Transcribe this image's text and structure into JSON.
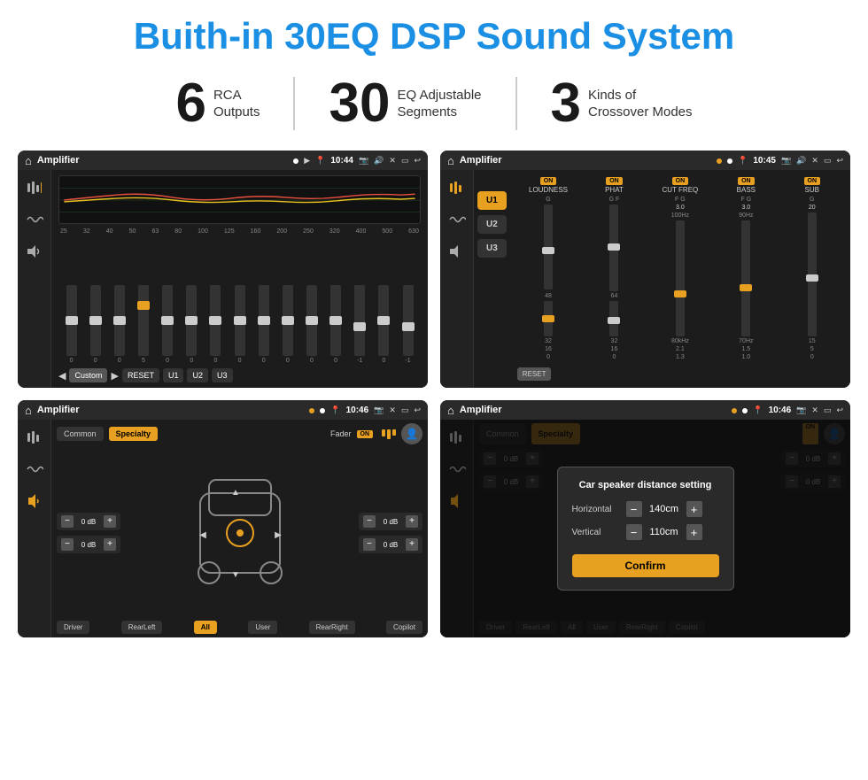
{
  "header": {
    "title": "Buith-in 30EQ DSP Sound System"
  },
  "stats": [
    {
      "number": "6",
      "label_line1": "RCA",
      "label_line2": "Outputs"
    },
    {
      "number": "30",
      "label_line1": "EQ Adjustable",
      "label_line2": "Segments"
    },
    {
      "number": "3",
      "label_line1": "Kinds of",
      "label_line2": "Crossover Modes"
    }
  ],
  "screens": [
    {
      "id": "eq-screen",
      "status_bar": {
        "title": "Amplifier",
        "time": "10:44"
      },
      "eq_labels": [
        "25",
        "32",
        "40",
        "50",
        "63",
        "80",
        "100",
        "125",
        "160",
        "200",
        "250",
        "320",
        "400",
        "500",
        "630"
      ],
      "eq_values": [
        0,
        0,
        0,
        5,
        0,
        0,
        0,
        0,
        0,
        0,
        0,
        0,
        -1,
        0,
        -1
      ],
      "bottom_buttons": [
        "Custom",
        "RESET",
        "U1",
        "U2",
        "U3"
      ]
    },
    {
      "id": "amp2-screen",
      "status_bar": {
        "title": "Amplifier",
        "time": "10:45"
      },
      "presets": [
        "U1",
        "U2",
        "U3"
      ],
      "channels": [
        {
          "name": "LOUDNESS",
          "on": true
        },
        {
          "name": "PHAT",
          "on": true
        },
        {
          "name": "CUT FREQ",
          "on": true
        },
        {
          "name": "BASS",
          "on": true
        },
        {
          "name": "SUB",
          "on": true
        }
      ],
      "reset_label": "RESET"
    },
    {
      "id": "specialty-screen",
      "status_bar": {
        "title": "Amplifier",
        "time": "10:46"
      },
      "tabs": [
        "Common",
        "Specialty"
      ],
      "fader_label": "Fader",
      "on_label": "ON",
      "speaker_left_top": "0 dB",
      "speaker_left_bottom": "0 dB",
      "speaker_right_top": "0 dB",
      "speaker_right_bottom": "0 dB",
      "bottom_buttons": [
        "Driver",
        "RearLeft",
        "All",
        "User",
        "RearRight",
        "Copilot"
      ]
    },
    {
      "id": "dialog-screen",
      "status_bar": {
        "title": "Amplifier",
        "time": "10:46"
      },
      "dialog": {
        "title": "Car speaker distance setting",
        "horizontal_label": "Horizontal",
        "horizontal_value": "140cm",
        "vertical_label": "Vertical",
        "vertical_value": "110cm",
        "confirm_label": "Confirm"
      },
      "tabs": [
        "Common",
        "Specialty"
      ],
      "bottom_buttons": [
        "Driver",
        "RearLeft",
        "All",
        "User",
        "RearRight",
        "Copilot"
      ]
    }
  ]
}
